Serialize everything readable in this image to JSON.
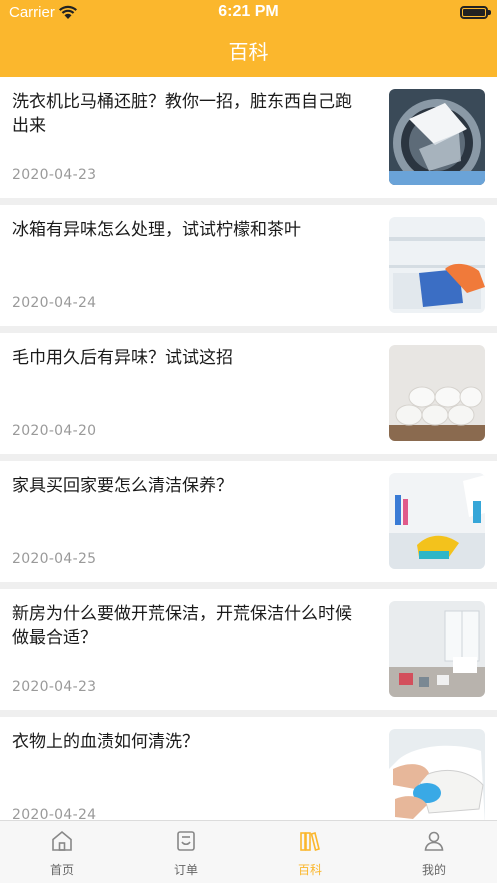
{
  "status_bar": {
    "carrier": "Carrier",
    "time": "6:21 PM"
  },
  "header": {
    "title": "百科"
  },
  "articles": [
    {
      "title": "洗衣机比马桶还脏？教你一招，脏东西自己跑出来",
      "date": "2020-04-23",
      "image": "washing-machine-drum"
    },
    {
      "title": "冰箱有异味怎么处理，试试柠檬和茶叶",
      "date": "2020-04-24",
      "image": "fridge-cleaning"
    },
    {
      "title": "毛巾用久后有异味？试试这招",
      "date": "2020-04-20",
      "image": "rolled-towels"
    },
    {
      "title": "家具买回家要怎么清洁保养？",
      "date": "2020-04-25",
      "image": "table-wiping"
    },
    {
      "title": "新房为什么要做开荒保洁，开荒保洁什么时候做最合适？",
      "date": "2020-04-23",
      "image": "empty-room"
    },
    {
      "title": "衣物上的血渍如何清洗？",
      "date": "2020-04-24",
      "image": "shoe-washing"
    }
  ],
  "tabs": [
    {
      "label": "首页",
      "icon": "home-icon",
      "active": false
    },
    {
      "label": "订单",
      "icon": "order-icon",
      "active": false
    },
    {
      "label": "百科",
      "icon": "books-icon",
      "active": true
    },
    {
      "label": "我的",
      "icon": "profile-icon",
      "active": false
    }
  ],
  "colors": {
    "accent": "#fbb72d",
    "tab_inactive": "#888888"
  }
}
